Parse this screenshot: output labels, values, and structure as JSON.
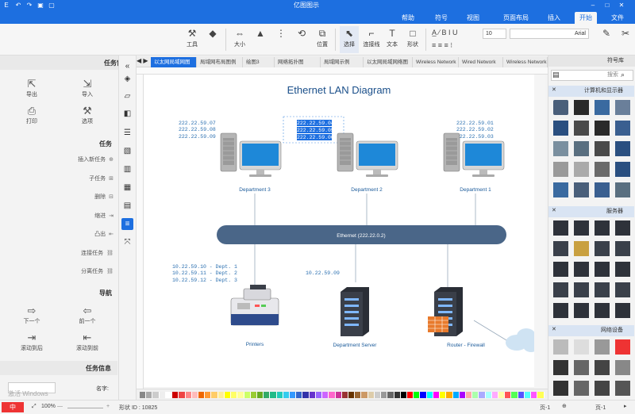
{
  "title": "亿图图示",
  "menu": {
    "file": "文件",
    "start": "开始",
    "insert": "插入",
    "page_layout": "页面布局",
    "view": "视图",
    "symbol": "符号",
    "help": "帮助"
  },
  "ribbon": {
    "tools": "工具",
    "size": "大小",
    "position": "位置",
    "select": "选择",
    "connector": "连接线",
    "text": "文本",
    "shape": "形状",
    "font": "Arial",
    "font_size": "10"
  },
  "doc_tabs": [
    "以太网局域网图",
    "局域网布局图例",
    "绘图3",
    "网络拓扑图",
    "局域网示例",
    "以太网局域网络图",
    "Wireless Network",
    "Wired Network",
    "Wireless Network"
  ],
  "left_panel": {
    "header": "任务窗格",
    "import": "导入",
    "export": "导出",
    "style": "选项",
    "print": "打印",
    "task_title": "任务",
    "tasks": [
      "插入新任务",
      "子任务",
      "删除",
      "缩进",
      "凸出",
      "连接任务",
      "分离任务"
    ],
    "nav_title": "导航",
    "nav": [
      "前一个",
      "下一个",
      "滚动到前",
      "滚动到后"
    ],
    "info_title": "任务信息",
    "name_label": "名字:"
  },
  "right_panel": {
    "header": "符号库",
    "search": "搜索",
    "section1": "计算机和显示器",
    "section2": "服务器",
    "section3": "网络设备"
  },
  "diagram": {
    "title": "Ethernet LAN Diagram",
    "bus": "Ethernet (222.22.0.2)",
    "dept1": "Department 1",
    "dept2": "Department 2",
    "dept3": "Department 3",
    "dept1_ips": [
      "222.22.59.01",
      "222.22.59.02",
      "222.22.59.03"
    ],
    "dept2_ips": [
      "222.22.59.04",
      "222.22.59.05",
      "222.22.59.06"
    ],
    "dept3_ips": [
      "222.22.59.07",
      "222.22.59.08",
      "222.22.59.09"
    ],
    "firewall": "Router - Firewall",
    "server": "Department Server",
    "server_ip": "10.22.59.09",
    "printers": "Printers",
    "printer_ips": [
      "10.22.59.10 - Dept. 1",
      "10.22.59.11 - Dept. 2",
      "10.22.59.12 - Dept. 3"
    ]
  },
  "status": {
    "page": "页-1",
    "page2": "页-1",
    "shape_id": "形状 ID : 10825",
    "zoom": "100%",
    "activate": "激活 Windows",
    "lang": "中"
  },
  "colors": {
    "brand": "#1d6fe0",
    "bus": "#4a6688",
    "text": "#1a5a9a"
  }
}
